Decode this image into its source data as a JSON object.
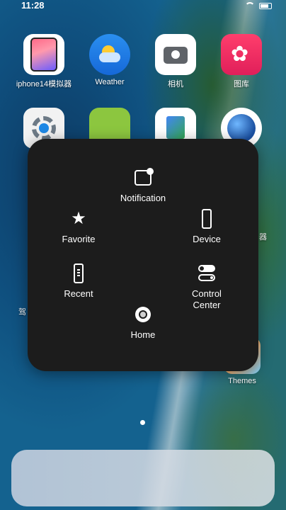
{
  "status_bar": {
    "time": "11:28"
  },
  "apps": [
    {
      "label": "iphone14模拟器",
      "icon": "phone-mockup-icon"
    },
    {
      "label": "Weather",
      "icon": "weather-icon"
    },
    {
      "label": "相机",
      "icon": "camera-icon"
    },
    {
      "label": "图库",
      "icon": "gallery-icon"
    },
    {
      "label": "",
      "icon": "settings-gear-icon"
    },
    {
      "label": "",
      "icon": "calculator-icon"
    },
    {
      "label": "",
      "icon": "files-icon"
    },
    {
      "label": "",
      "icon": "browser-globe-icon"
    }
  ],
  "partial_labels": {
    "left_row3": "驾",
    "right_row3": "器"
  },
  "assistive_menu": {
    "notification": "Notification",
    "favorite": "Favorite",
    "device": "Device",
    "recent": "Recent",
    "control_center_line1": "Control",
    "control_center_line2": "Center",
    "home": "Home"
  },
  "themes_app": {
    "label": "Themes"
  },
  "colors": {
    "panel": "#1c1c1c",
    "accent_white": "#ffffff"
  }
}
